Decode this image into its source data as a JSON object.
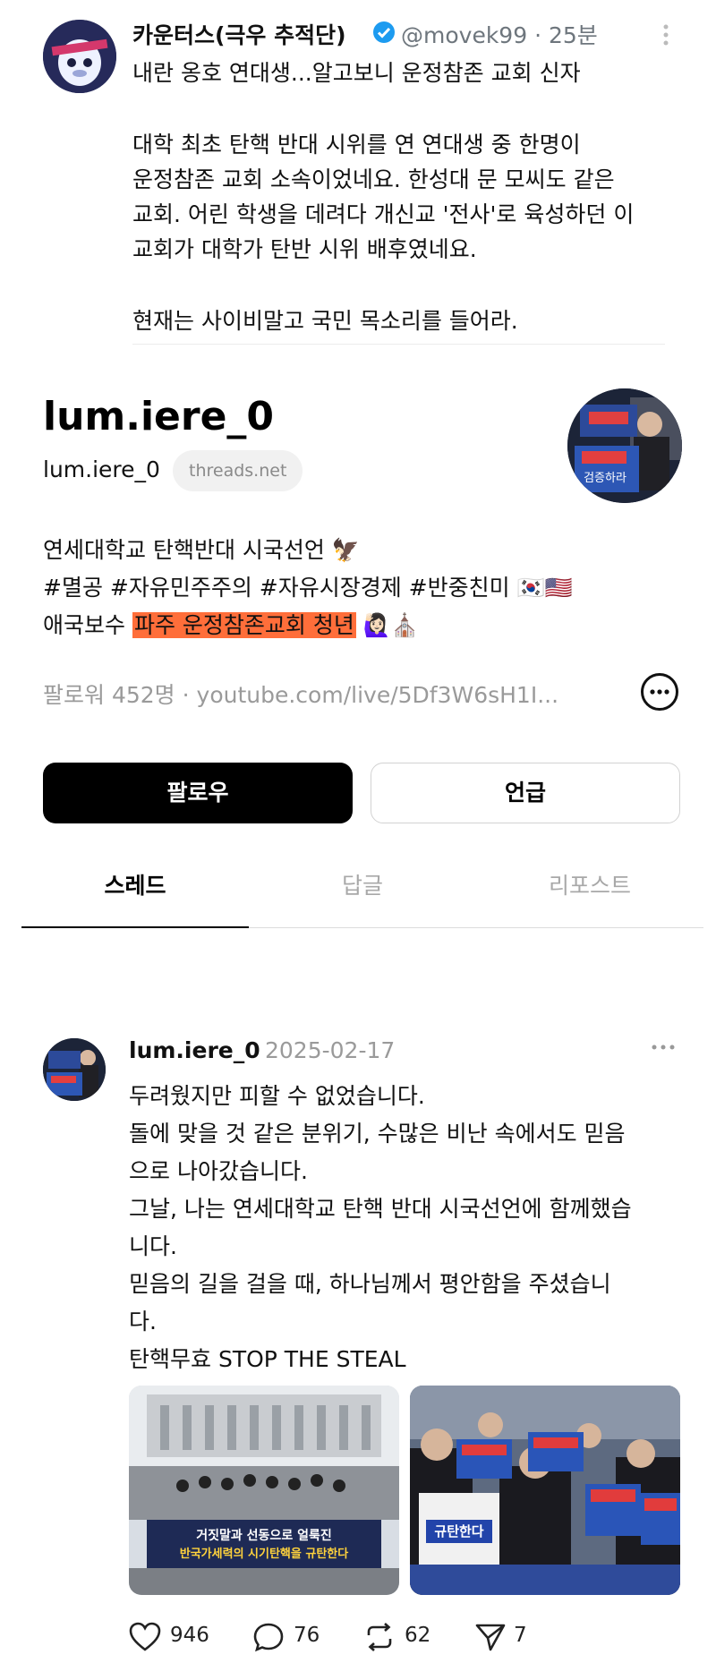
{
  "tweet": {
    "author_name": "카운터스(극우 추적단)",
    "handle": "@movek99",
    "time": "· 25분",
    "lines": [
      "내란 옹호 연대생...알고보니 운정참존 교회 신자",
      "대학 최초 탄핵 반대 시위를 연 연대생 중 한명이",
      "운정참존 교회 소속이었네요. 한성대 문 모씨도 같은",
      "교회. 어린 학생을 데려다 개신교 '전사'로 육성하던 이",
      "교회가 대학가 탄반 시위 배후였네요.",
      "현재는 사이비말고 국민 목소리를 들어라."
    ]
  },
  "profile": {
    "display_name": "lum.iere_0",
    "username": "lum.iere_0",
    "domain_chip": "threads.net",
    "bio_line1": "연세대학교 탄핵반대 시국선언 🦅",
    "bio_line2": "#멸공 #자유민주주의 #자유시장경제 #반중친미 🇰🇷🇺🇸",
    "bio_line3_prefix": "애국보수 ",
    "bio_line3_highlight": "파주 운정참존교회 청년",
    "bio_line3_suffix": " 🙋🏻‍♀️⛪",
    "followers": "팔로워 452명",
    "link": "youtube.com/live/5Df3W6sH1I..."
  },
  "buttons": {
    "follow": "팔로우",
    "mention": "언급"
  },
  "tabs": [
    "스레드",
    "답글",
    "리포스트"
  ],
  "post": {
    "username": "lum.iere_0",
    "date": "2025-02-17",
    "lines": [
      "두려웠지만 피할 수 없었습니다.",
      "돌에 맞을 것 같은 분위기, 수많은 비난 속에서도 믿음",
      "으로 나아갔습니다.",
      "그날, 나는 연세대학교 탄핵 반대 시국선언에 함께했습",
      "니다.",
      "믿음의 길을 걸을 때, 하나님께서 평안함을 주셨습니",
      "다.",
      "탄핵무효 STOP THE STEAL"
    ],
    "image1_banner": "거짓말과 선동으로 얼룩진",
    "image1_banner2": "반국가세력의 시기탄핵을 규탄한다",
    "image2_sign": "규탄한다",
    "sign_text": "검증하라",
    "likes": "946",
    "comments": "76",
    "reposts": "62",
    "shares": "7"
  },
  "icons": {
    "verified": "verified-badge-icon",
    "like": "heart-icon",
    "comment": "comment-icon",
    "repost": "repost-icon",
    "share": "share-icon"
  },
  "colors": {
    "highlight": "#ff6e3a",
    "verified": "#1d9bf0",
    "muted": "#9a9a9a"
  }
}
